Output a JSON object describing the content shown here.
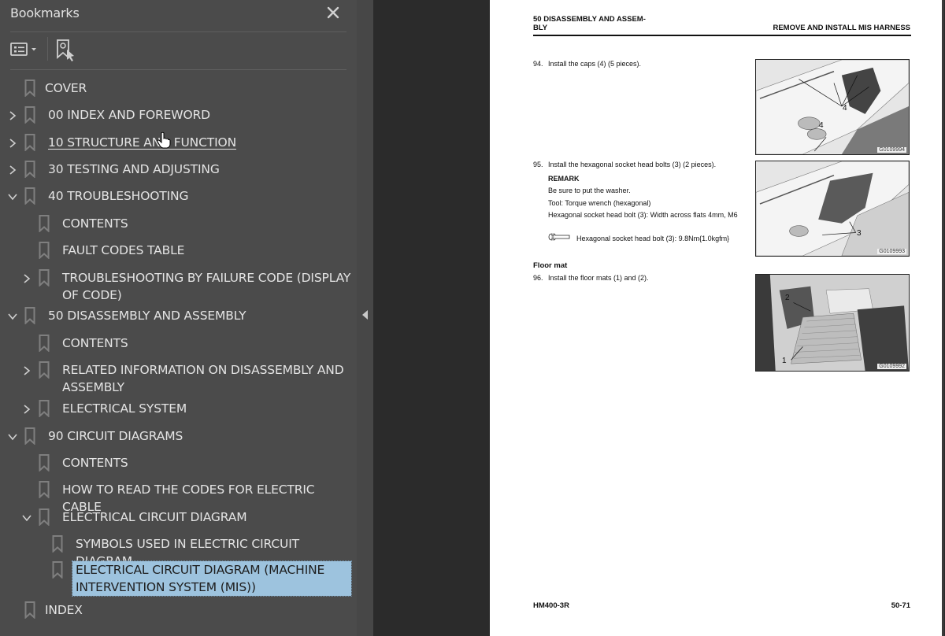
{
  "sidebar": {
    "title": "Bookmarks",
    "close_icon": "close-icon",
    "toolbar": {
      "options_icon": "bookmark-options-icon",
      "find_icon": "find-current-bookmark-icon"
    },
    "items": [
      {
        "label": "COVER",
        "level": 0,
        "expander": "none"
      },
      {
        "label": "00 INDEX AND FOREWORD",
        "level": 0,
        "expander": "collapsed"
      },
      {
        "label": "10 STRUCTURE AND FUNCTION",
        "level": 0,
        "expander": "collapsed",
        "hovered": true
      },
      {
        "label": "30 TESTING AND ADJUSTING",
        "level": 0,
        "expander": "collapsed"
      },
      {
        "label": "40 TROUBLESHOOTING",
        "level": 0,
        "expander": "expanded"
      },
      {
        "label": "CONTENTS",
        "level": 1,
        "expander": "none"
      },
      {
        "label": "FAULT CODES TABLE",
        "level": 1,
        "expander": "none"
      },
      {
        "label": "TROUBLESHOOTING BY FAILURE CODE (DISPLAY OF CODE)",
        "level": 1,
        "expander": "collapsed"
      },
      {
        "label": "50 DISASSEMBLY AND ASSEMBLY",
        "level": 0,
        "expander": "expanded"
      },
      {
        "label": "CONTENTS",
        "level": 1,
        "expander": "none"
      },
      {
        "label": "RELATED INFORMATION ON DISASSEMBLY AND ASSEMBLY",
        "level": 1,
        "expander": "collapsed"
      },
      {
        "label": "ELECTRICAL SYSTEM",
        "level": 1,
        "expander": "collapsed"
      },
      {
        "label": "90 CIRCUIT DIAGRAMS",
        "level": 0,
        "expander": "expanded"
      },
      {
        "label": "CONTENTS",
        "level": 1,
        "expander": "none"
      },
      {
        "label": "HOW TO READ THE CODES FOR ELECTRIC CABLE",
        "level": 1,
        "expander": "none"
      },
      {
        "label": "ELECTRICAL CIRCUIT DIAGRAM",
        "level": 1,
        "expander": "expanded"
      },
      {
        "label": "SYMBOLS USED IN ELECTRIC CIRCUIT DIAGRAM",
        "level": 2,
        "expander": "none"
      },
      {
        "label": "ELECTRICAL CIRCUIT DIAGRAM (MACHINE INTERVENTION SYSTEM (MIS))",
        "level": 2,
        "expander": "none",
        "selected": true
      },
      {
        "label": "INDEX",
        "level": 0,
        "expander": "none"
      }
    ]
  },
  "page": {
    "header_left": "50 DISASSEMBLY AND ASSEM-\nBLY",
    "header_right": "REMOVE AND INSTALL MIS HARNESS",
    "steps": [
      {
        "num": "94.",
        "text": "Install the caps (4) (5 pieces)."
      },
      {
        "num": "95.",
        "text": "Install the hexagonal socket head bolts (3) (2 pieces)."
      },
      {
        "num": "96.",
        "text": "Install the floor mats (1) and (2)."
      }
    ],
    "remark": {
      "title": "REMARK",
      "lines": [
        "Be sure to put the washer.",
        "Tool: Torque wrench (hexagonal)",
        "Hexagonal socket head bolt (3): Width across flats 4mm, M6"
      ],
      "torque": "Hexagonal socket head bolt (3): 9.8Nm{1.0kgfm}"
    },
    "section_title": "Floor mat",
    "figures": [
      {
        "id": "G0109994",
        "callouts": [
          "4",
          "4"
        ]
      },
      {
        "id": "G0109993",
        "callouts": [
          "3"
        ]
      },
      {
        "id": "G0109992",
        "callouts": [
          "2",
          "1"
        ]
      }
    ],
    "footer_left": "HM400-3R",
    "footer_right": "50-71"
  },
  "colors": {
    "sidebar_bg": "#4b4b4b",
    "doc_bg": "#2b2b2b",
    "selection": "#9dc3de"
  }
}
